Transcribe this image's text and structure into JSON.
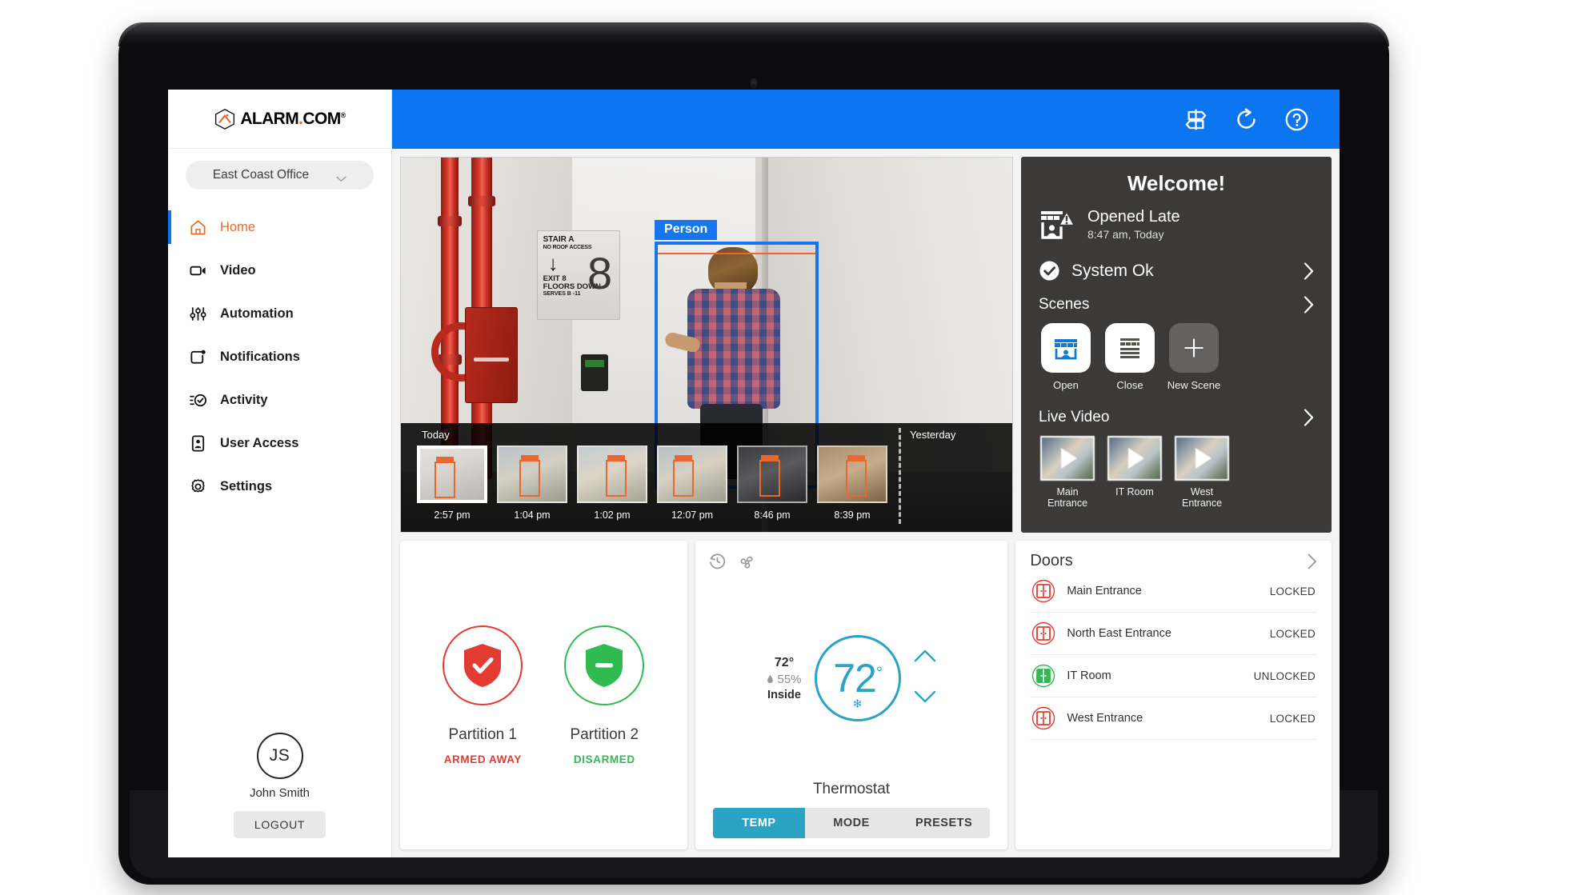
{
  "brand": {
    "name": "ALARM",
    "dot": ".",
    "suffix": "COM",
    "reg": "®"
  },
  "sidebar": {
    "site_selector": {
      "label": "East Coast Office",
      "icon": "chevron-down-icon"
    },
    "items": [
      {
        "label": "Home",
        "icon": "home-icon",
        "active": true
      },
      {
        "label": "Video",
        "icon": "video-camera-icon",
        "active": false
      },
      {
        "label": "Automation",
        "icon": "sliders-icon",
        "active": false
      },
      {
        "label": "Notifications",
        "icon": "notification-bell-icon",
        "active": false
      },
      {
        "label": "Activity",
        "icon": "activity-check-icon",
        "active": false
      },
      {
        "label": "User Access",
        "icon": "user-badge-icon",
        "active": false
      },
      {
        "label": "Settings",
        "icon": "gear-icon",
        "active": false
      }
    ],
    "profile": {
      "initials": "JS",
      "name": "John Smith",
      "logout_label": "LOGOUT"
    }
  },
  "topbar": {
    "accent_color": "#0b76ef",
    "icons": [
      {
        "name": "signpost-icon"
      },
      {
        "name": "refresh-icon"
      },
      {
        "name": "help-circle-icon"
      }
    ]
  },
  "camera": {
    "detection_label": "Person",
    "detection_color": "#1576f0",
    "sign": {
      "line1": "STAIR A",
      "line2": "NO ROOF ACCESS",
      "arrow": "↓",
      "line3": "EXIT 8",
      "line4": "FLOORS DOWN",
      "line5": "SERVES B -11"
    },
    "door_number": "8",
    "timeline": {
      "today_label": "Today",
      "yesterday_label": "Yesterday",
      "clips": [
        {
          "time": "2:57 pm",
          "day": "today",
          "selected": true
        },
        {
          "time": "1:04 pm",
          "day": "today",
          "selected": false
        },
        {
          "time": "1:02 pm",
          "day": "today",
          "selected": false
        },
        {
          "time": "12:07 pm",
          "day": "today",
          "selected": false
        },
        {
          "time": "8:46 pm",
          "day": "yesterday",
          "selected": false
        },
        {
          "time": "8:39 pm",
          "day": "yesterday",
          "selected": false
        }
      ]
    }
  },
  "right_panel": {
    "welcome": "Welcome!",
    "alert": {
      "title": "Opened Late",
      "subtitle": "8:47 am, Today",
      "icon": "storefront-alert-icon"
    },
    "system_status": {
      "text": "System Ok",
      "icon": "check-circle-icon"
    },
    "scenes": {
      "title": "Scenes",
      "items": [
        {
          "label": "Open",
          "icon": "storefront-open-icon"
        },
        {
          "label": "Close",
          "icon": "storefront-closed-icon"
        },
        {
          "label": "New Scene",
          "icon": "plus-icon"
        }
      ]
    },
    "live_video": {
      "title": "Live Video",
      "cameras": [
        {
          "label": "Main\nEntrance",
          "line1": "Main",
          "line2": "Entrance"
        },
        {
          "label": "IT Room",
          "line1": "IT Room",
          "line2": ""
        },
        {
          "label": "West\nEntrance",
          "line1": "West",
          "line2": "Entrance"
        }
      ]
    }
  },
  "partitions": {
    "items": [
      {
        "name": "Partition 1",
        "state": "ARMED AWAY",
        "state_kind": "armed",
        "color": "#e23b32",
        "icon": "shield-check-icon"
      },
      {
        "name": "Partition 2",
        "state": "DISARMED",
        "state_kind": "disarmed",
        "color": "#2fbb4f",
        "icon": "shield-minus-icon"
      }
    ]
  },
  "thermostat": {
    "name": "Thermostat",
    "setpoint": "72",
    "degree": "°",
    "inside_temp": "72°",
    "humidity": "55%",
    "inside_label": "Inside",
    "mode_icon": "snowflake-icon",
    "accent_color": "#2ba3c4",
    "top_icons": [
      {
        "name": "schedule-clock-icon"
      },
      {
        "name": "fan-icon"
      }
    ],
    "tabs": [
      {
        "label": "TEMP",
        "active": true
      },
      {
        "label": "MODE",
        "active": false
      },
      {
        "label": "PRESETS",
        "active": false
      }
    ]
  },
  "doors": {
    "title": "Doors",
    "rows": [
      {
        "name": "Main Entrance",
        "state": "LOCKED",
        "locked": true,
        "color": "#e23b32"
      },
      {
        "name": "North East Entrance",
        "state": "LOCKED",
        "locked": true,
        "color": "#e23b32"
      },
      {
        "name": "IT Room",
        "state": "UNLOCKED",
        "locked": false,
        "color": "#2fbb4f"
      },
      {
        "name": "West Entrance",
        "state": "LOCKED",
        "locked": true,
        "color": "#e23b32"
      }
    ]
  }
}
